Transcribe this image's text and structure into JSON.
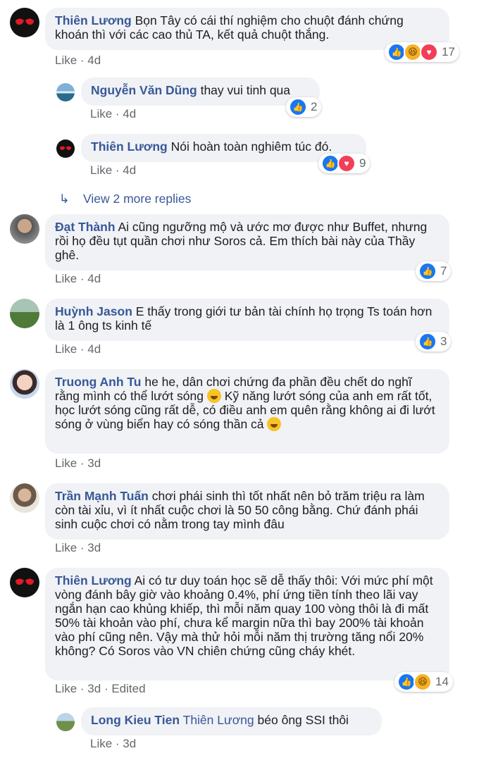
{
  "comments": [
    {
      "name": "Thiên Lương",
      "text": "Bọn Tây có cái thí nghiệm cho chuột đánh chứng khoán thì với các cao thủ TA, kết quả chuột thắng.",
      "like": "Like",
      "time": "4d",
      "reactions": "17",
      "replies": [
        {
          "name": "Nguyễn Văn Dũng",
          "text": "thay vui tinh qua",
          "like": "Like",
          "time": "4d",
          "reactions": "2"
        },
        {
          "name": "Thiên Lương",
          "text": "Nói hoàn toàn nghiêm túc đó.",
          "like": "Like",
          "time": "4d",
          "reactions": "9"
        }
      ],
      "view_more": "View 2 more replies"
    },
    {
      "name": "Đạt Thành",
      "text": "Ai cũng ngưỡng mộ và ước mơ được như Buffet, nhưng rồi họ đều tụt quần chơi như Soros cả. Em thích bài này của Thầy ghê.",
      "like": "Like",
      "time": "4d",
      "reactions": "7"
    },
    {
      "name": "Huỳnh Jason",
      "text": "E thấy trong giới tư bản tài chính họ trọng Ts toán hơn là 1 ông ts kinh tế",
      "like": "Like",
      "time": "4d",
      "reactions": "3"
    },
    {
      "name": "Truong Anh Tu",
      "text": "he he, dân chơi chứng đa phần đều chết do nghĩ rằng mình có thể lướt sóng",
      "text2": " Kỹ năng lướt sóng của anh em rất tốt, học lướt sóng cũng rất dễ, có điều anh em quên rằng không ai đi lướt sóng ở vùng biển hay có sóng thần cả",
      "like": "Like",
      "time": "3d"
    },
    {
      "name": "Trần Mạnh Tuấn",
      "text": "chơi phái sinh thì tốt nhất nên bỏ trăm triệu ra làm còn tài xỉu, vì ít nhất cuộc chơi là 50 50 công bằng. Chứ đánh phái sinh cuộc chơi có nằm trong tay mình đâu",
      "like": "Like",
      "time": "3d"
    },
    {
      "name": "Thiên Lương",
      "text": "Ai có tư duy toán học sẽ dễ thấy thôi: Với mức phí một vòng đánh bây giờ vào khoảng 0.4%, phí ứng tiền tính theo lãi vay ngắn hạn cao khủng khiếp, thì mỗi năm quay 100 vòng thôi là đi mất 50% tài khoản vào phí, chưa kể margin nữa thì bay 200% tài khoản vào phí cũng nên. Vậy mà thử hỏi mỗi năm thị trường tăng nổi 20% không? Có Soros vào VN chiên chứng cũng cháy khét.",
      "like": "Like",
      "time": "3d",
      "edited": "Edited",
      "reactions": "14",
      "replies": [
        {
          "name": "Long Kieu Tien",
          "mention": "Thiên Lương",
          "text": "béo ông SSI thôi",
          "like": "Like",
          "time": "3d"
        }
      ]
    }
  ],
  "sep": " · "
}
